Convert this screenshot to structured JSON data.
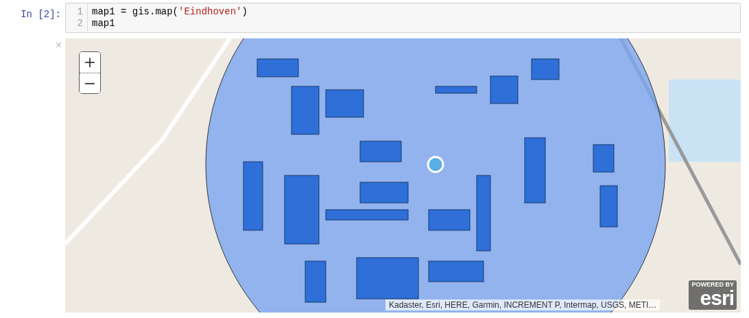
{
  "cell": {
    "prompt": "In [2]:",
    "lines": [
      {
        "number": "1",
        "tokens": [
          {
            "kind": "plain",
            "text": "map1 = gis.map("
          },
          {
            "kind": "string",
            "text": "'Eindhoven'"
          },
          {
            "kind": "plain",
            "text": ")"
          }
        ]
      },
      {
        "number": "2",
        "tokens": [
          {
            "kind": "plain",
            "text": "map1"
          }
        ]
      }
    ]
  },
  "output": {
    "close": "×",
    "zoom_in": "+",
    "zoom_out": "−",
    "attribution": "Kadaster, Esri, HERE, Garmin, INCREMENT P, Intermap, USGS, METI…",
    "logo": {
      "caption": "POWERED BY",
      "wordmark": "esri"
    }
  }
}
